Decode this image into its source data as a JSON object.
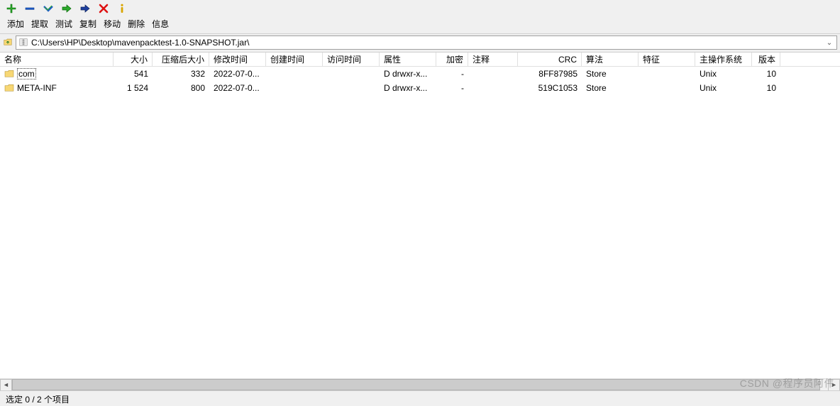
{
  "toolbar": {
    "items": [
      {
        "label": "添加",
        "icon": "plus-icon"
      },
      {
        "label": "提取",
        "icon": "minus-icon"
      },
      {
        "label": "测试",
        "icon": "check-down-icon"
      },
      {
        "label": "复制",
        "icon": "arrow-right-outline-icon"
      },
      {
        "label": "移动",
        "icon": "arrow-right-solid-icon"
      },
      {
        "label": "删除",
        "icon": "x-icon"
      },
      {
        "label": "信息",
        "icon": "info-icon"
      }
    ]
  },
  "addressbar": {
    "path": "C:\\Users\\HP\\Desktop\\mavenpacktest-1.0-SNAPSHOT.jar\\"
  },
  "columns": [
    {
      "key": "name",
      "label": "名称",
      "cls": "c-name"
    },
    {
      "key": "size",
      "label": "大小",
      "cls": "c-size num"
    },
    {
      "key": "packed",
      "label": "压缩后大小",
      "cls": "c-packed num"
    },
    {
      "key": "mod",
      "label": "修改时间",
      "cls": "c-mod"
    },
    {
      "key": "create",
      "label": "创建时间",
      "cls": "c-create"
    },
    {
      "key": "access",
      "label": "访问时间",
      "cls": "c-access"
    },
    {
      "key": "attr",
      "label": "属性",
      "cls": "c-attr"
    },
    {
      "key": "enc",
      "label": "加密",
      "cls": "c-enc num"
    },
    {
      "key": "comm",
      "label": "注释",
      "cls": "c-comm"
    },
    {
      "key": "crc",
      "label": "CRC",
      "cls": "c-crc num"
    },
    {
      "key": "algo",
      "label": "算法",
      "cls": "c-algo"
    },
    {
      "key": "feat",
      "label": "特征",
      "cls": "c-feat"
    },
    {
      "key": "os",
      "label": "主操作系统",
      "cls": "c-os"
    },
    {
      "key": "ver",
      "label": "版本",
      "cls": "c-ver num"
    }
  ],
  "rows": [
    {
      "name": "com",
      "selected": true,
      "size": "541",
      "packed": "332",
      "mod": "2022-07-0...",
      "create": "",
      "access": "",
      "attr": "D drwxr-x...",
      "enc": "-",
      "comm": "",
      "crc": "8FF87985",
      "algo": "Store",
      "feat": "",
      "os": "Unix",
      "ver": "10"
    },
    {
      "name": "META-INF",
      "selected": false,
      "size": "1 524",
      "packed": "800",
      "mod": "2022-07-0...",
      "create": "",
      "access": "",
      "attr": "D drwxr-x...",
      "enc": "-",
      "comm": "",
      "crc": "519C1053",
      "algo": "Store",
      "feat": "",
      "os": "Unix",
      "ver": "10"
    }
  ],
  "status": {
    "text": "选定 0 / 2 个项目"
  },
  "watermark": "CSDN @程序员阿伟"
}
